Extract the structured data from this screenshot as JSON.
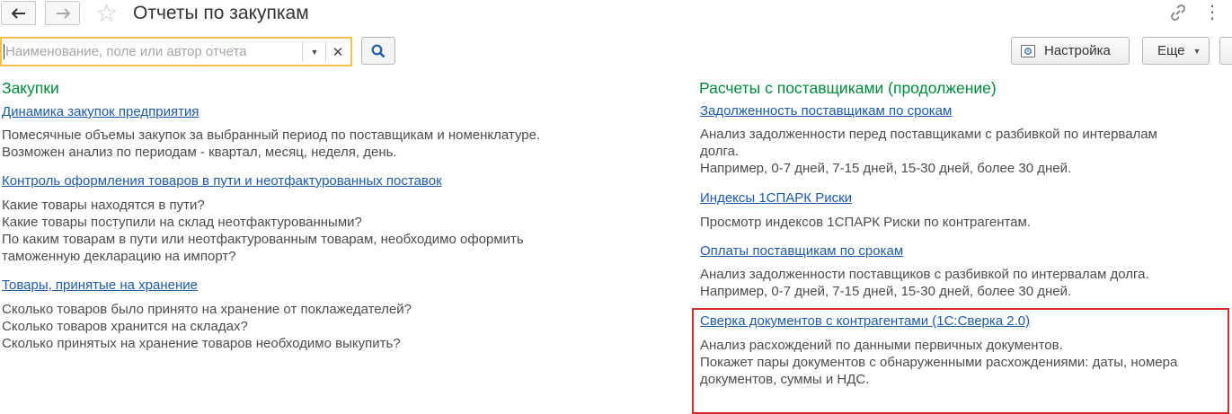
{
  "window": {
    "title": "Отчеты по закупкам"
  },
  "search": {
    "value": "",
    "placeholder": "Наименование, поле или автор отчета"
  },
  "toolbar": {
    "settings_label": "Настройка",
    "more_label": "Еще"
  },
  "left_section": {
    "heading": "Закупки",
    "reports": [
      {
        "title": "Динамика закупок предприятия",
        "description": [
          "Помесячные объемы закупок за выбранный период по поставщикам и номенклатуре.",
          "Возможен анализ по периодам - квартал, месяц, неделя, день."
        ]
      },
      {
        "title": "Контроль оформления товаров в пути и неотфактурованных поставок",
        "description": [
          "Какие товары находятся в пути?",
          "Какие товары поступили на склад неотфактурованными?",
          "По каким товарам в пути или неотфактурованным товарам, необходимо оформить",
          "таможенную декларацию на импорт?"
        ]
      },
      {
        "title": "Товары, принятые на хранение",
        "description": [
          "Сколько товаров было принято на хранение от поклажедателей?",
          "Сколько товаров хранится на складах?",
          "Сколько принятых на хранение товаров необходимо выкупить?"
        ]
      }
    ]
  },
  "right_section": {
    "heading": "Расчеты с поставщиками (продолжение)",
    "reports": [
      {
        "title": "Задолженность поставщикам по срокам",
        "description": [
          "Анализ задолженности перед поставщиками с разбивкой по интервалам",
          "долга.",
          "Например, 0-7 дней, 7-15 дней, 15-30 дней, более 30 дней."
        ]
      },
      {
        "title": "Индексы 1СПАРК Риски",
        "description": [
          "Просмотр индексов 1СПАРК Риски по контрагентам."
        ]
      },
      {
        "title": "Оплаты поставщикам по срокам",
        "description": [
          "Анализ задолженности поставщиков с разбивкой по интервалам долга.",
          "Например, 0-7 дней, 7-15 дней, 15-30 дней, более 30 дней."
        ]
      },
      {
        "title": "Сверка документов с контрагентами (1С:Сверка 2.0)",
        "description": [
          "Анализ расхождений по данными первичных документов.",
          "Покажет пары документов с обнаруженными расхождениями: даты, номера",
          "документов, суммы и НДС."
        ],
        "highlighted": true
      }
    ]
  },
  "colors": {
    "heading_green": "#008a3e",
    "link_blue": "#1d5bab",
    "search_focus": "#f5c048",
    "highlight_red": "#d62b2b"
  },
  "icons": [
    "back-arrow-icon",
    "forward-arrow-icon",
    "star-icon",
    "link-icon",
    "more-vertical-icon",
    "dropdown-icon",
    "clear-icon",
    "search-icon",
    "settings-icon"
  ]
}
